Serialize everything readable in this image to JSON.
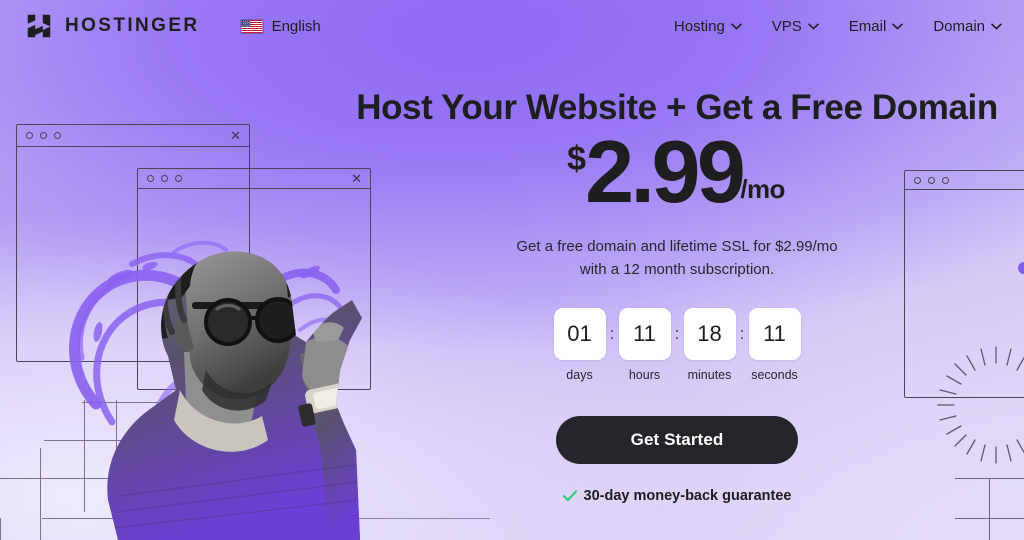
{
  "brand": {
    "name": "HOSTINGER",
    "logo_icon": "hostinger-h-logo"
  },
  "language": {
    "label": "English",
    "flag_icon": "us-flag-icon"
  },
  "nav": {
    "items": [
      {
        "label": "Hosting",
        "icon": "chevron-down-icon"
      },
      {
        "label": "VPS",
        "icon": "chevron-down-icon"
      },
      {
        "label": "Email",
        "icon": "chevron-down-icon"
      },
      {
        "label": "Domain",
        "icon": "chevron-down-icon"
      }
    ]
  },
  "hero": {
    "headline": "Host Your Website + Get a Free Domain",
    "price": {
      "currency": "$",
      "amount": "2.99",
      "period": "/mo"
    },
    "subtitle_line1": "Get a free domain and lifetime SSL for $2.99/mo",
    "subtitle_line2": "with a 12 month subscription.",
    "cta_label": "Get Started",
    "guarantee": "30-day money-back guarantee",
    "guarantee_icon": "green-check-icon"
  },
  "countdown": {
    "separator": ":",
    "units": [
      {
        "value": "01",
        "label": "days"
      },
      {
        "value": "11",
        "label": "hours"
      },
      {
        "value": "18",
        "label": "minutes"
      },
      {
        "value": "11",
        "label": "seconds"
      }
    ]
  },
  "colors": {
    "brand_purple": "#8c68f4",
    "background_light": "#e9e3fb",
    "text_dark": "#1d1e20",
    "cta_background": "#25252c",
    "cta_text": "#ffffff",
    "check_green": "#2ecd72",
    "timer_box": "#ffffff"
  },
  "decorations": {
    "browser_windows": 3,
    "sunburst_icon": "sunburst-icon",
    "brush_stroke_icon": "purple-brush-swoosh",
    "portrait_alt": "man-with-dreadlocks-and-sunglasses"
  }
}
